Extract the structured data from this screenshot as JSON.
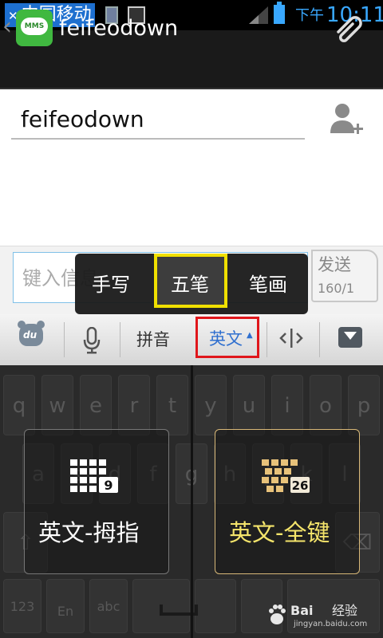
{
  "status_bar": {
    "carrier": "中国移动",
    "ampm": "下午",
    "clock": "10:11"
  },
  "title_bar": {
    "title": "feifeodown"
  },
  "recipient": {
    "value": "feifeodown"
  },
  "compose": {
    "placeholder_visible": "键入信息",
    "send_label": "发送",
    "counter": "160/1"
  },
  "input_popup": {
    "options": [
      "手写",
      "五笔",
      "笔画"
    ],
    "highlighted": "五笔"
  },
  "toolbar": {
    "pinyin": "拼音",
    "english": "英文",
    "selected": "英文"
  },
  "keyboard": {
    "row1": [
      "q",
      "w",
      "e",
      "r",
      "t",
      "y",
      "u",
      "i",
      "o",
      "p"
    ],
    "row2": [
      "a",
      "s",
      "d",
      "f",
      "g",
      "h",
      "j",
      "k",
      "l"
    ],
    "bottom_left": [
      "123",
      "En",
      "abc"
    ],
    "mode_panels": [
      {
        "label": "英文-拇指",
        "icon_badge": "9",
        "selected": false
      },
      {
        "label": "英文-全键",
        "icon_badge": "26",
        "selected": true
      }
    ]
  },
  "watermark": {
    "brand": "Bai",
    "brand_tail": "经验",
    "site": "jingyan.baidu.com"
  },
  "colors": {
    "accent_blue": "#39a8ff",
    "highlight_yellow": "#f0e000",
    "highlight_red": "#e0161b",
    "mms_green": "#40b840"
  }
}
